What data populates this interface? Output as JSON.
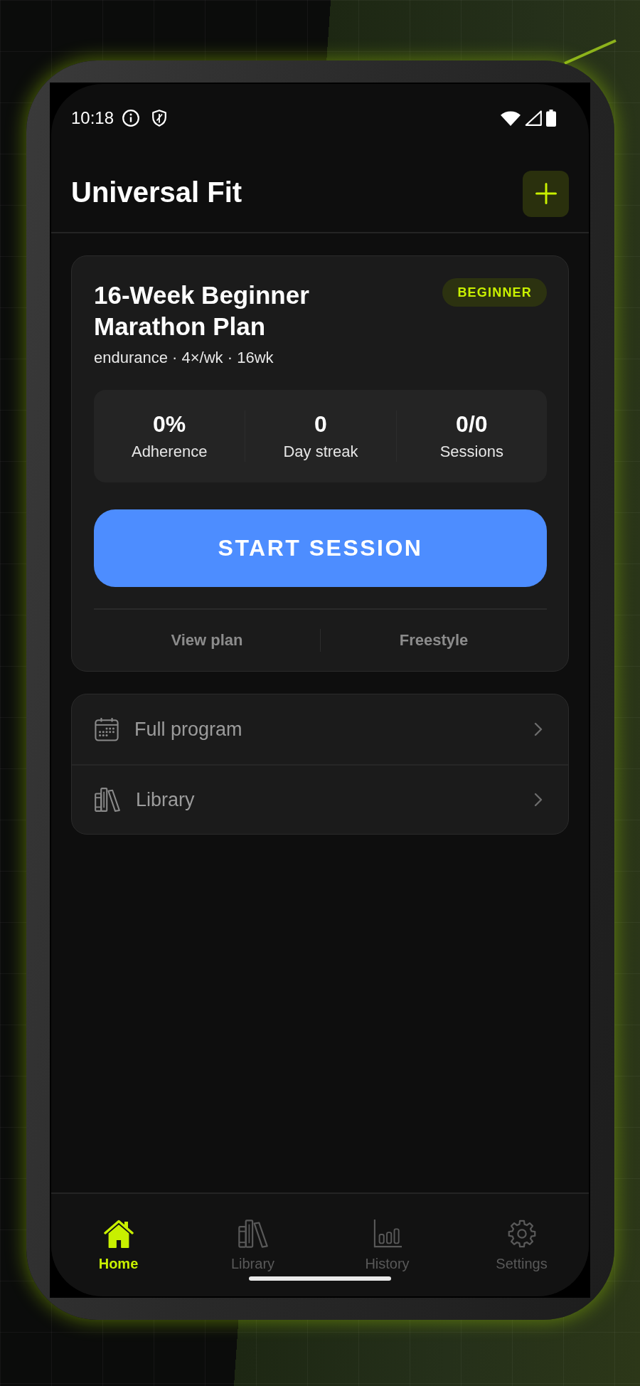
{
  "status_bar": {
    "time": "10:18"
  },
  "header": {
    "title": "Universal Fit"
  },
  "plan_card": {
    "title": "16-Week Beginner Marathon Plan",
    "badge": "BEGINNER",
    "meta": "endurance · 4×/wk · 16wk",
    "stats": [
      {
        "value": "0%",
        "label": "Adherence"
      },
      {
        "value": "0",
        "label": "Day streak"
      },
      {
        "value": "0/0",
        "label": "Sessions"
      }
    ],
    "primary_button": "START SESSION",
    "secondary_buttons": [
      "View plan",
      "Freestyle"
    ]
  },
  "menu": [
    {
      "label": "Full program"
    },
    {
      "label": "Library"
    }
  ],
  "bottom_nav": [
    {
      "label": "Home",
      "selected": true
    },
    {
      "label": "Library",
      "selected": false
    },
    {
      "label": "History",
      "selected": false
    },
    {
      "label": "Settings",
      "selected": false
    }
  ]
}
